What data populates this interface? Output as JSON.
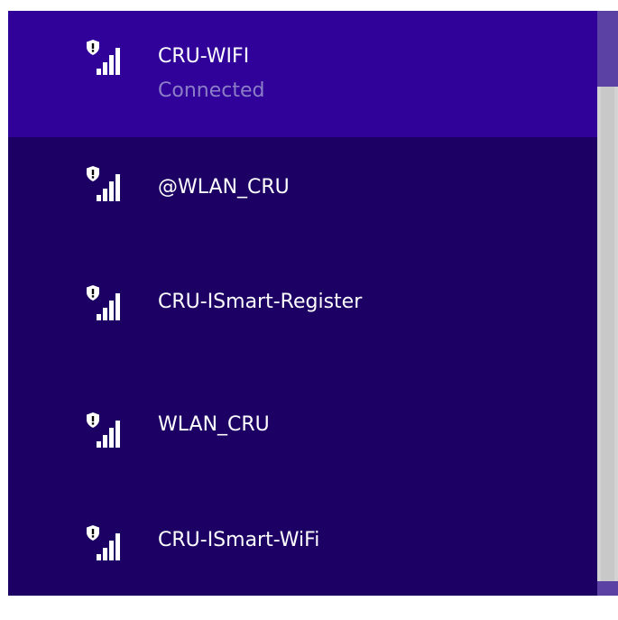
{
  "networks": [
    {
      "name": "CRU-WIFI",
      "status": "Connected",
      "icon": "secured-wifi-signal-icon",
      "selected": true
    },
    {
      "name": "@WLAN_CRU",
      "icon": "secured-wifi-signal-icon"
    },
    {
      "name": "CRU-ISmart-Register",
      "icon": "secured-wifi-signal-icon"
    },
    {
      "name": "WLAN_CRU",
      "icon": "secured-wifi-signal-icon"
    },
    {
      "name": "CRU-ISmart-WiFi",
      "icon": "secured-wifi-signal-icon"
    }
  ],
  "colors": {
    "list_background": "#1d0063",
    "selected_background": "#31029a",
    "status_text": "#8c7fc7",
    "scrollbar_accent": "#5b41a4"
  }
}
